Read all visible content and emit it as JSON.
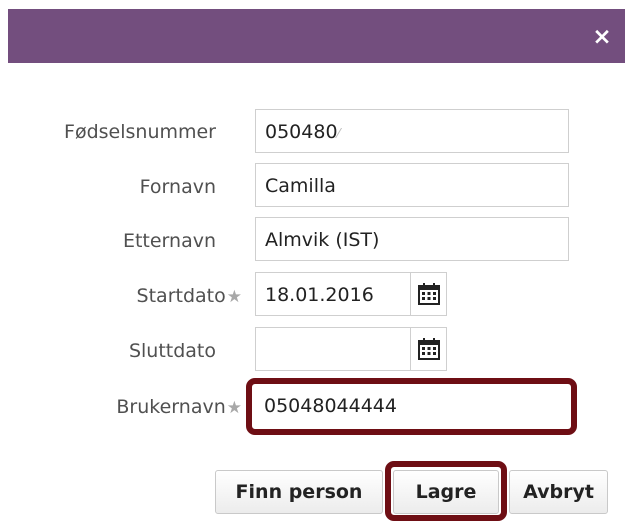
{
  "dialog": {
    "close_icon": "close-icon",
    "close_glyph": "×"
  },
  "fields": {
    "fodselsnummer": {
      "label": "Fødselsnummer",
      "value": "050480"
    },
    "fornavn": {
      "label": "Fornavn",
      "value": "Camilla"
    },
    "etternavn": {
      "label": "Etternavn",
      "value": "Almvik (IST)"
    },
    "startdato": {
      "label": "Startdato",
      "required_marker": "★",
      "value": "18.01.2016",
      "icon": "calendar-icon"
    },
    "sluttdato": {
      "label": "Sluttdato",
      "value": "",
      "icon": "calendar-icon"
    },
    "brukernavn": {
      "label": "Brukernavn",
      "required_marker": "★",
      "value": "05048044444"
    }
  },
  "buttons": {
    "finn_person": "Finn person",
    "lagre": "Lagre",
    "avbryt": "Avbryt"
  },
  "colors": {
    "titlebar": "#734e7e",
    "highlight": "#6e0e14"
  }
}
